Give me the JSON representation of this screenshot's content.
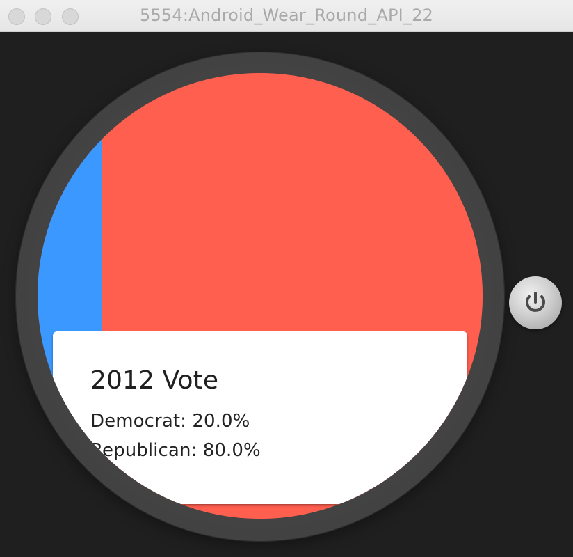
{
  "window": {
    "title": "5554:Android_Wear_Round_API_22",
    "controls": [
      "close",
      "minimize",
      "zoom"
    ]
  },
  "device": {
    "power_button_icon": "power-icon"
  },
  "chart_data": {
    "type": "bar",
    "categories": [
      "Democrat",
      "Republican"
    ],
    "values": [
      20.0,
      80.0
    ],
    "colors": [
      "#3a98ff",
      "#ff5f4f"
    ]
  },
  "card": {
    "title": "2012 Vote",
    "democrat_line": "Democrat: 20.0%",
    "republican_line": "Republican: 80.0%"
  },
  "colors": {
    "democrat": "#3a98ff",
    "republican": "#ff5f4f",
    "bezel": "#454545",
    "window_background": "#1f1f1f"
  }
}
